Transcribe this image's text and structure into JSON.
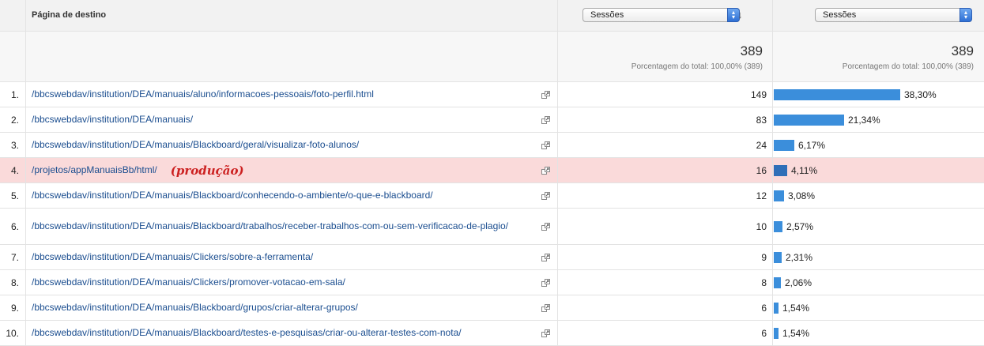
{
  "header": {
    "page_col_title": "Página de destino",
    "metric1_select": "Sessões",
    "metric2_select": "Sessões"
  },
  "totals": {
    "metric1_value": "389",
    "metric1_pct": "Porcentagem do total: 100,00% (389)",
    "metric2_value": "389",
    "metric2_pct": "Porcentagem do total: 100,00% (389)"
  },
  "colors": {
    "bar": "#3b8edb",
    "bar_highlight": "#2f6fb8",
    "highlight_row": "#fadada",
    "annotation": "#cc2020"
  },
  "rows": [
    {
      "num": "1.",
      "page": "/bbcswebdav/institution/DEA/manuais/aluno/informacoes-pessoais/foto-perfil.html",
      "value": "149",
      "pct": "38,30%",
      "share": 0.383
    },
    {
      "num": "2.",
      "page": "/bbcswebdav/institution/DEA/manuais/",
      "value": "83",
      "pct": "21,34%",
      "share": 0.2134
    },
    {
      "num": "3.",
      "page": "/bbcswebdav/institution/DEA/manuais/Blackboard/geral/visualizar-foto-alunos/",
      "value": "24",
      "pct": "6,17%",
      "share": 0.0617
    },
    {
      "num": "4.",
      "page": "/projetos/appManuaisBb/html/",
      "annotation": "(produção)",
      "highlight": true,
      "value": "16",
      "pct": "4,11%",
      "share": 0.0411
    },
    {
      "num": "5.",
      "page": "/bbcswebdav/institution/DEA/manuais/Blackboard/conhecendo-o-ambiente/o-que-e-blackboard/",
      "value": "12",
      "pct": "3,08%",
      "share": 0.0308
    },
    {
      "num": "6.",
      "page": "/bbcswebdav/institution/DEA/manuais/Blackboard/trabalhos/receber-trabalhos-com-ou-sem-verificacao-de-plagio/",
      "tall": true,
      "value": "10",
      "pct": "2,57%",
      "share": 0.0257
    },
    {
      "num": "7.",
      "page": "/bbcswebdav/institution/DEA/manuais/Clickers/sobre-a-ferramenta/",
      "value": "9",
      "pct": "2,31%",
      "share": 0.0231
    },
    {
      "num": "8.",
      "page": "/bbcswebdav/institution/DEA/manuais/Clickers/promover-votacao-em-sala/",
      "value": "8",
      "pct": "2,06%",
      "share": 0.0206
    },
    {
      "num": "9.",
      "page": "/bbcswebdav/institution/DEA/manuais/Blackboard/grupos/criar-alterar-grupos/",
      "value": "6",
      "pct": "1,54%",
      "share": 0.0154
    },
    {
      "num": "10.",
      "page": "/bbcswebdav/institution/DEA/manuais/Blackboard/testes-e-pesquisas/criar-ou-alterar-testes-com-nota/",
      "value": "6",
      "pct": "1,54%",
      "share": 0.0154
    }
  ]
}
